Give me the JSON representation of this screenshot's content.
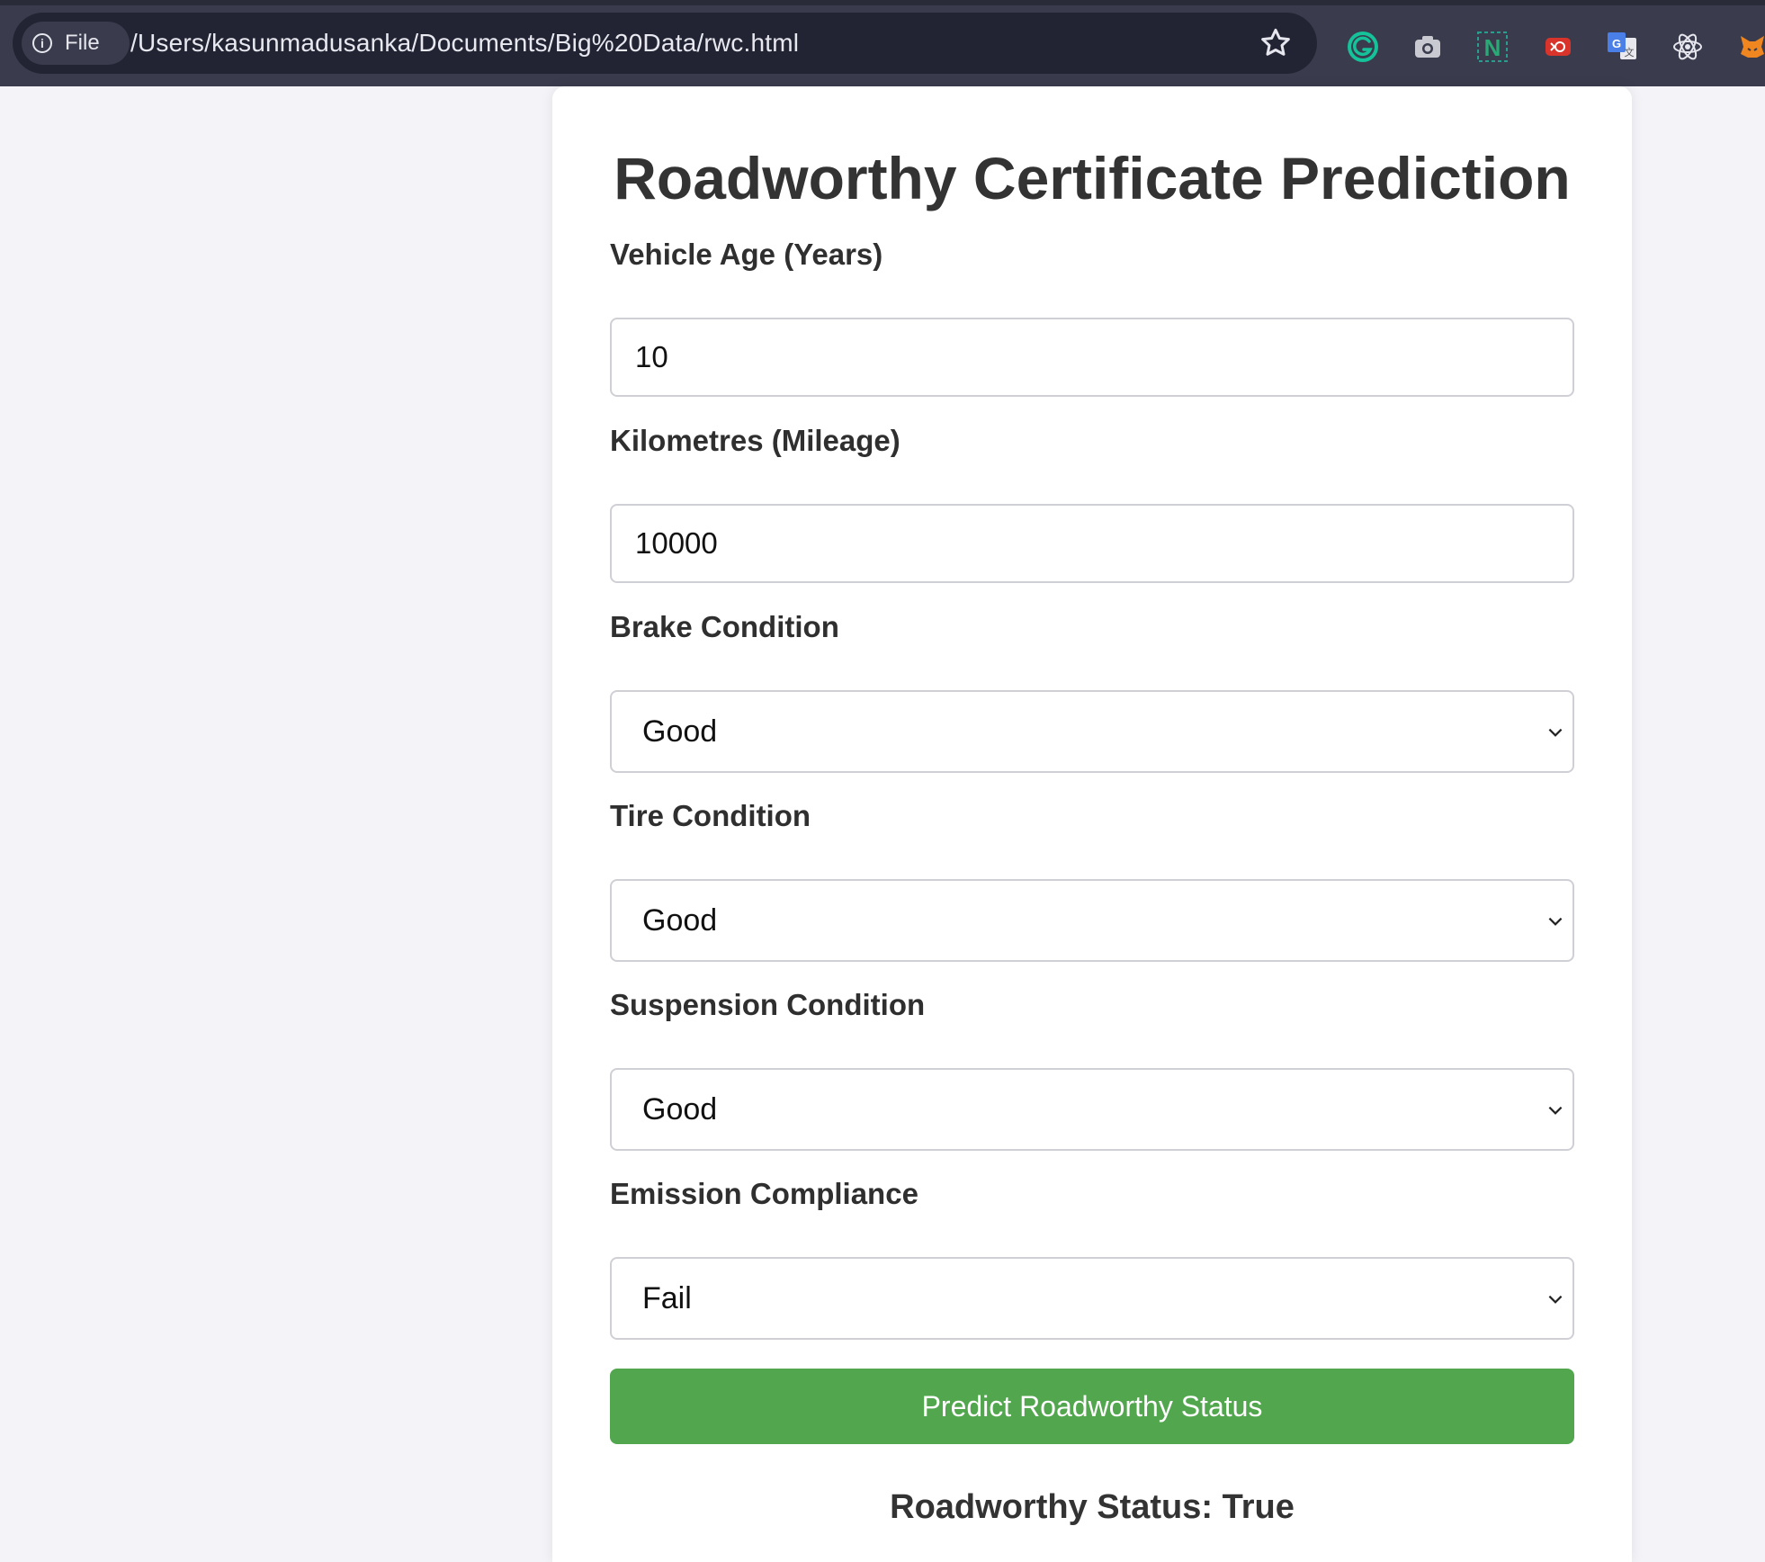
{
  "browser": {
    "scheme_label": "File",
    "url": "/Users/kasunmadusanka/Documents/Big%20Data/rwc.html",
    "extensions": [
      "grammarly-icon",
      "camera-icon",
      "notion-icon",
      "red-extension-icon",
      "google-translate-icon",
      "react-devtools-icon",
      "metamask-icon"
    ]
  },
  "form": {
    "title": "Roadworthy Certificate Prediction",
    "vehicle_age": {
      "label": "Vehicle Age (Years)",
      "value": "10"
    },
    "kilometres": {
      "label": "Kilometres (Mileage)",
      "value": "10000"
    },
    "brake": {
      "label": "Brake Condition",
      "value": "Good"
    },
    "tire": {
      "label": "Tire Condition",
      "value": "Good"
    },
    "suspension": {
      "label": "Suspension Condition",
      "value": "Good"
    },
    "emission": {
      "label": "Emission Compliance",
      "value": "Fail"
    },
    "submit_label": "Predict Roadworthy Status",
    "result": "Roadworthy Status: True"
  },
  "colors": {
    "button": "#52a64e",
    "toolbar": "#3a3b4c",
    "page_bg": "#f3f3f8"
  }
}
